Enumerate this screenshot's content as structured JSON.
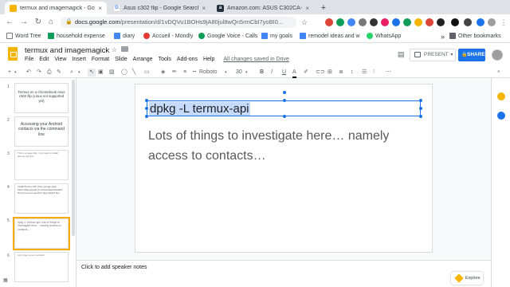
{
  "tabs": [
    {
      "title": "termux and imagemagick - Goo",
      "favicon": "slides-icon",
      "color": "#f4b400"
    },
    {
      "title": "Asus c302 flip - Google Search",
      "favicon": "google-icon",
      "color": "#4285f4"
    },
    {
      "title": "Amazon.com: ASUS C302CA-DH",
      "favicon": "amazon-icon",
      "color": "#232f3e"
    }
  ],
  "address": {
    "host": "docs.google.com",
    "path": "/presentation/d/1vDQVu1BOHs9jA80jul8wQn5rmCbI7yoBI0..."
  },
  "bookmarks": [
    {
      "label": "Word Tree"
    },
    {
      "label": "household expense"
    },
    {
      "label": "diary"
    },
    {
      "label": "Accueil - Mondly"
    },
    {
      "label": "Google Voice - Calls"
    },
    {
      "label": "my goals"
    },
    {
      "label": "remodel ideas and w"
    },
    {
      "label": "WhatsApp"
    },
    {
      "label": "Other bookmarks"
    }
  ],
  "document": {
    "title": "termux and imagemagick",
    "menu": [
      "File",
      "Edit",
      "View",
      "Insert",
      "Format",
      "Slide",
      "Arrange",
      "Tools",
      "Add-ons",
      "Help"
    ],
    "save_status": "All changes saved in Drive",
    "present_label": "PRESENT",
    "share_label": "SHARE"
  },
  "format_toolbar": {
    "font": "Roboto",
    "font_size": "30"
  },
  "slides": [
    {
      "number": "1",
      "text": "Termux on a chromebook Asus c302 flip (Linux not supported yet)"
    },
    {
      "number": "2",
      "text": "Accessing your Android contacts via the command line"
    },
    {
      "number": "3",
      "text": "This is a page filler. You need to install termux-api first."
    },
    {
      "number": "4",
      "text": "Install Termux:API (from google play) https://play.google.com/store/apps/details?id=com.termux.api Run pkg install Then"
    },
    {
      "number": "5",
      "text": "dpkg -L termux-api Lots of things to investigate here… namely access to contacts…"
    },
    {
      "number": "6",
      "text": "Let's grep some numbers"
    }
  ],
  "current_slide": {
    "title": "dpkg -L termux-api",
    "body": "Lots of things to investigate here… namely access to contacts…"
  },
  "notes_placeholder": "Click to add speaker notes",
  "explore_label": "Explore",
  "colors": {
    "accent": "#1a73e8",
    "selection": "#c6dafc",
    "slides_brand": "#f4b400"
  }
}
